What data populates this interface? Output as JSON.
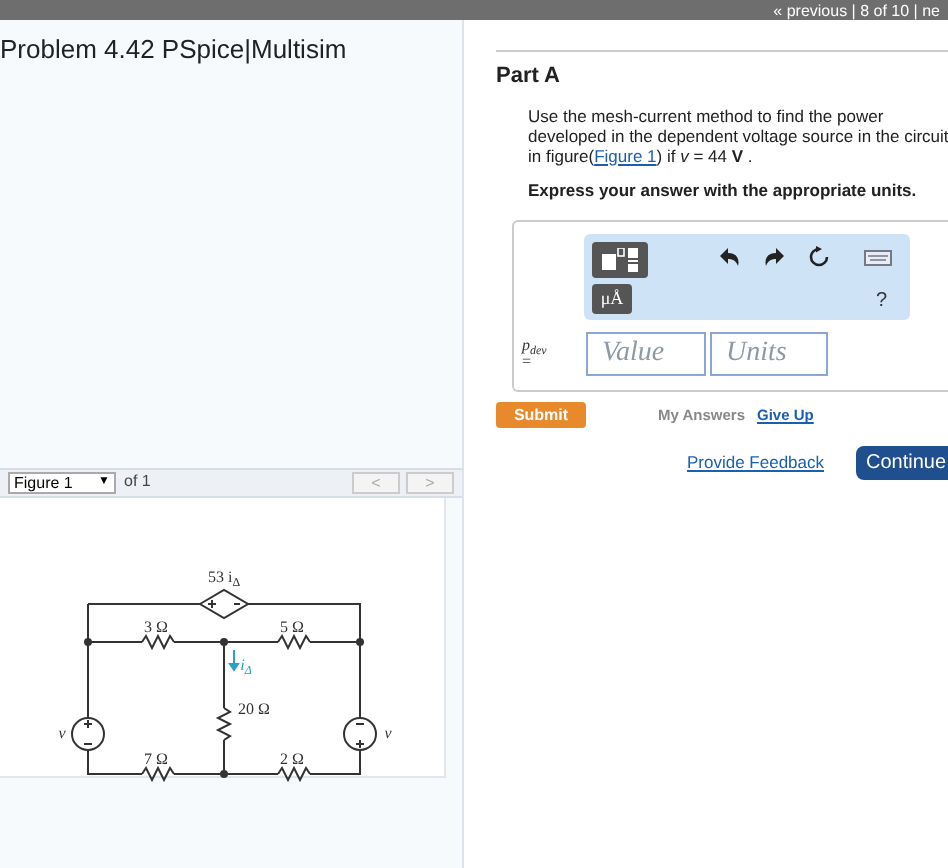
{
  "top_bar": {
    "nav": "« previous | 8 of 10 | ne"
  },
  "problem": {
    "title": "Problem 4.42 PSpice|Multisim"
  },
  "figure_nav": {
    "selector": "Figure 1",
    "selector_arrow": "▼",
    "count": "of 1",
    "prev": "<",
    "next": ">"
  },
  "figure": {
    "labels": [
      {
        "text": "53 i",
        "sub": "Δ"
      },
      {
        "text": "3 Ω"
      },
      {
        "text": "5 Ω"
      },
      {
        "text": "i",
        "sub": "Δ"
      },
      {
        "text": "20 Ω"
      },
      {
        "text": "7 Ω"
      },
      {
        "text": "2 Ω"
      },
      {
        "text": "v"
      },
      {
        "text": "v"
      }
    ]
  },
  "part": {
    "title": "Part A",
    "question": {
      "before": "Use the mesh-current method to find the power developed in the dependent voltage source in the circuit in figure(",
      "link": "Figure 1",
      "after": ") if *v* = 44 **V** ."
    },
    "instruction": "Express your answer with the appropriate units.",
    "toolbar": {
      "units_button": "μÅ",
      "help": "?"
    },
    "answer": {
      "label": "p$_{dev}$",
      "equals": "=",
      "value_placeholder": "Value",
      "units_placeholder": "Units"
    },
    "submit": "Submit",
    "my_answers": "My Answers",
    "give_up": "Give Up",
    "feedback": "Provide Feedback",
    "continue": "Continue"
  }
}
